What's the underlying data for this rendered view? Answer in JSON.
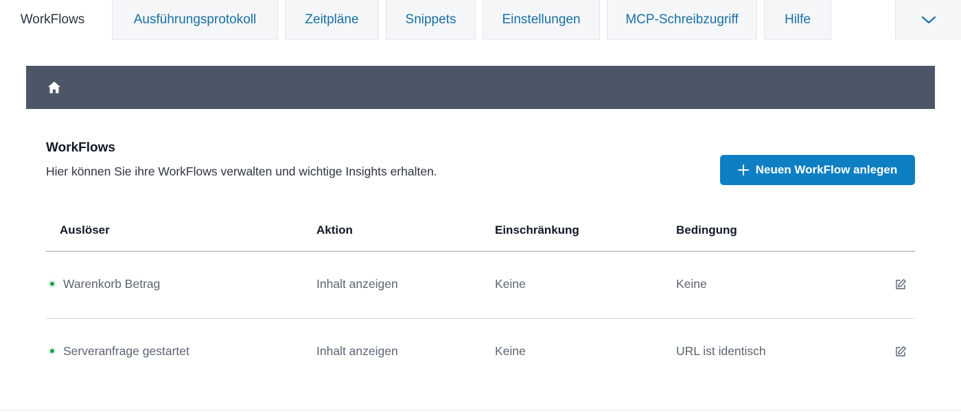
{
  "tabs": [
    {
      "label": "WorkFlows",
      "active": true
    },
    {
      "label": "Ausführungsprotokoll",
      "active": false
    },
    {
      "label": "Zeitpläne",
      "active": false
    },
    {
      "label": "Snippets",
      "active": false
    },
    {
      "label": "Einstellungen",
      "active": false
    },
    {
      "label": "MCP-Schreibzugriff",
      "active": false
    },
    {
      "label": "Hilfe",
      "active": false
    }
  ],
  "tab_overflow_icon": "chevron-down-icon",
  "breadcrumb": {
    "icon": "home-icon"
  },
  "header": {
    "title": "WorkFlows",
    "description": "Hier können Sie ihre WorkFlows verwalten und wichtige Insights erhalten.",
    "new_button_label": "Neuen WorkFlow anlegen",
    "new_button_icon": "plus-icon"
  },
  "table": {
    "columns": [
      "Auslöser",
      "Aktion",
      "Einschränkung",
      "Bedingung"
    ],
    "rows": [
      {
        "trigger": "Warenkorb Betrag",
        "action": "Inhalt anzeigen",
        "restriction": "Keine",
        "condition": "Keine",
        "status": "active"
      },
      {
        "trigger": "Serveranfrage gestartet",
        "action": "Inhalt anzeigen",
        "restriction": "Keine",
        "condition": "URL ist identisch",
        "status": "active"
      }
    ]
  },
  "colors": {
    "accent": "#0f7fc4",
    "tab_text": "#1a6fa3",
    "breadcrumb_bg": "#4c5666",
    "status_active": "#22a04b"
  }
}
